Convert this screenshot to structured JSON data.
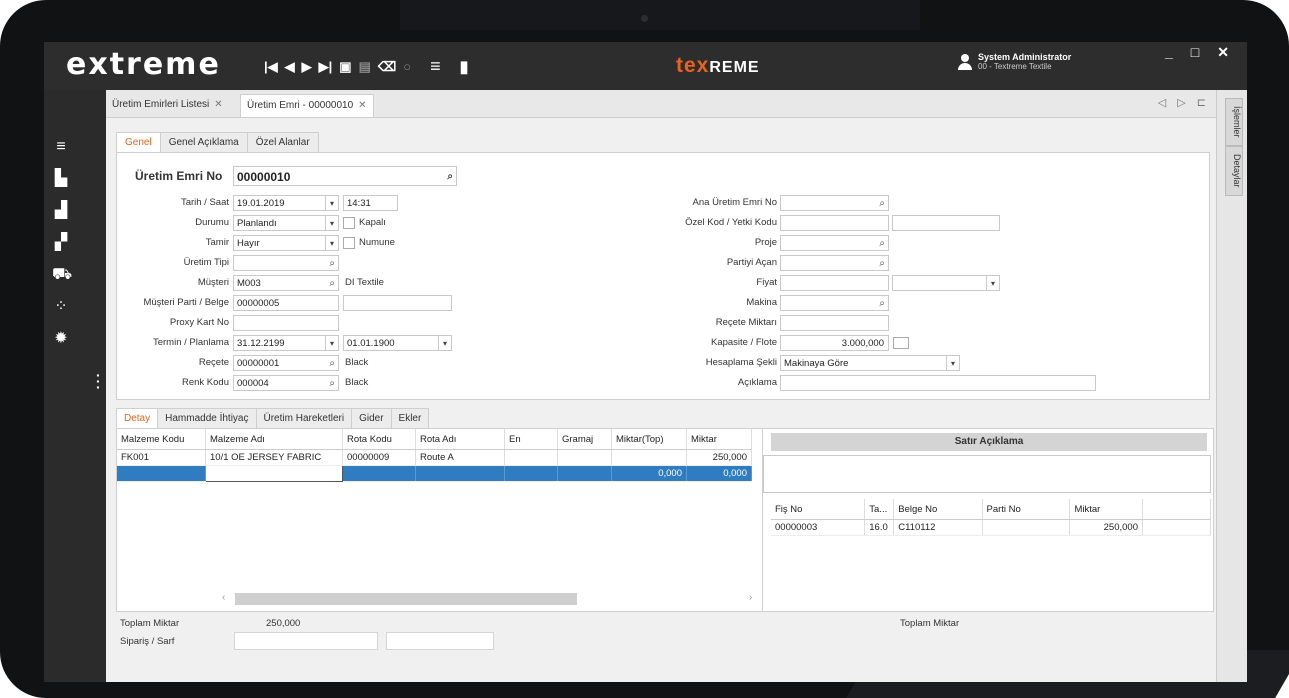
{
  "topbar": {
    "logo": "extreme",
    "brand_main": "tex",
    "brand_rest": "REME",
    "user_name": "System Administrator",
    "user_company": "00 - Textreme Textile",
    "win_min": "_",
    "win_max": "□",
    "win_close": "✕"
  },
  "doc_tabs": [
    {
      "label": "Üretim Emirleri Listesi",
      "close": "✕"
    },
    {
      "label": "Üretim Emri - 00000010",
      "close": "✕"
    }
  ],
  "doc_nav": "◁ ▷ ⊏",
  "right_tabs": [
    "İşlemler",
    "Detaylar"
  ],
  "form_tabs": [
    "Genel",
    "Genel Açıklama",
    "Özel Alanlar"
  ],
  "form": {
    "order_no_label": "Üretim Emri No",
    "order_no": "00000010",
    "date_label": "Tarih / Saat",
    "date": "19.01.2019",
    "time": "14:31",
    "status_label": "Durumu",
    "status": "Planlandı",
    "closed_label": "Kapalı",
    "repair_label": "Tamir",
    "repair": "Hayır",
    "sample_label": "Numune",
    "type_label": "Üretim Tipi",
    "type": "",
    "customer_label": "Müşteri",
    "customer": "M003",
    "customer_name": "DI Textile",
    "customer_batch_label": "Müşteri Parti / Belge",
    "customer_batch": "00000005",
    "proxy_label": "Proxy Kart No",
    "proxy": "",
    "deadline_label": "Termin / Planlama",
    "deadline": "31.12.2199",
    "planning": "01.01.1900",
    "recipe_label": "Reçete",
    "recipe": "00000001",
    "recipe_name": "Black",
    "color_label": "Renk Kodu",
    "color": "000004",
    "color_name": "Black",
    "main_order_label": "Ana Üretim Emri No",
    "special_code_label": "Özel Kod / Yetki Kodu",
    "project_label": "Proje",
    "batch_opener_label": "Partiyi Açan",
    "price_label": "Fiyat",
    "machine_label": "Makina",
    "recipe_qty_label": "Reçete Miktarı",
    "capacity_label": "Kapasite / Flote",
    "capacity": "3.000,000",
    "calc_label": "Hesaplama Şekli",
    "calc": "Makinaya Göre",
    "description_label": "Açıklama"
  },
  "bottom_tabs": [
    "Detay",
    "Hammadde İhtiyaç",
    "Üretim Hareketleri",
    "Gider",
    "Ekler"
  ],
  "detail_grid": {
    "columns": [
      "Malzeme Kodu",
      "Malzeme Adı",
      "Rota Kodu",
      "Rota Adı",
      "En",
      "Gramaj",
      "Miktar(Top)",
      "Miktar"
    ],
    "rows": [
      [
        "FK001",
        "10/1 OE JERSEY FABRIC",
        "00000009",
        "Route A",
        "",
        "",
        "",
        "250,000"
      ],
      [
        "",
        "",
        "",
        "",
        "",
        "",
        "0,000",
        "0,000"
      ]
    ]
  },
  "right_panel": {
    "title": "Satır Açıklama",
    "columns": [
      "Fiş No",
      "Ta...",
      "Belge No",
      "Parti No",
      "Miktar"
    ],
    "rows": [
      [
        "00000003",
        "16.0",
        "C110112",
        "",
        "250,000"
      ]
    ]
  },
  "footer": {
    "total_label": "Toplam Miktar",
    "total_value": "250,000",
    "order_label": "Sipariş / Sarf",
    "right_total_label": "Toplam Miktar"
  }
}
